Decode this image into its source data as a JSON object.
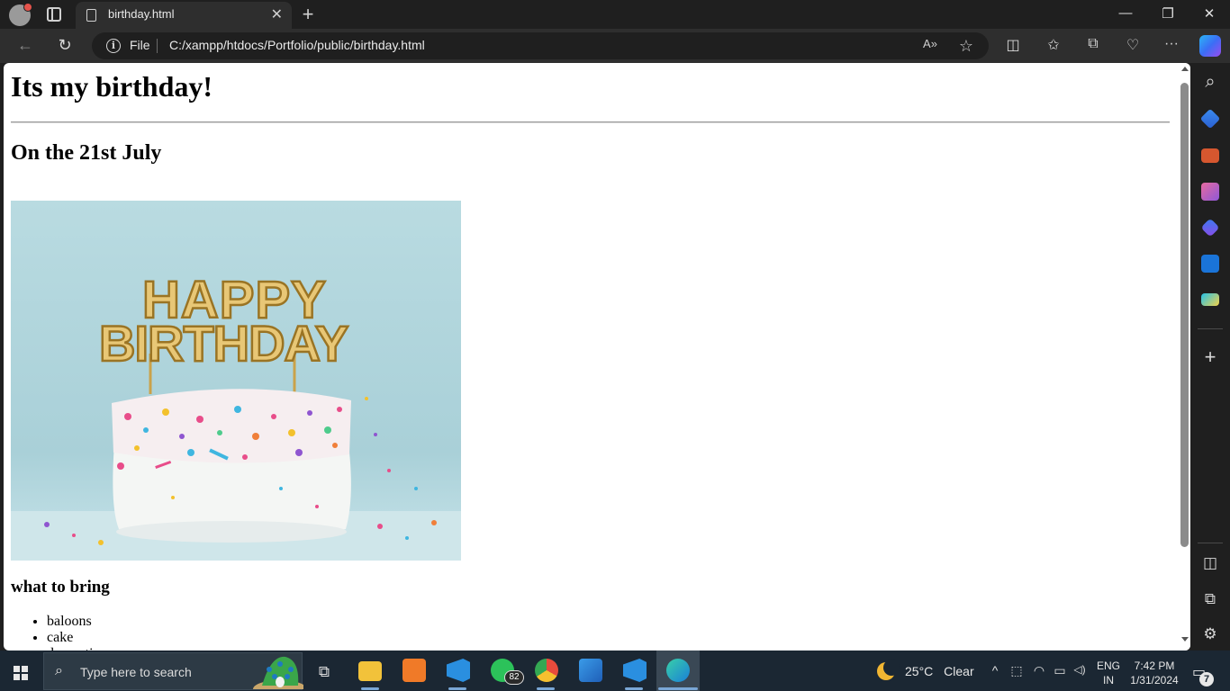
{
  "browser": {
    "tab_title": "birthday.html",
    "tab_close_glyph": "✕",
    "new_tab_glyph": "+",
    "window_controls": {
      "minimize": "—",
      "restore": "❐",
      "close": "✕"
    },
    "back_glyph": "←",
    "refresh_glyph": "↻",
    "info_glyph": "i",
    "file_label": "File",
    "url": "C:/xampp/htdocs/Portfolio/public/birthday.html",
    "read_aloud_glyph": "A»",
    "favorite_glyph": "☆",
    "split_glyph": "◫",
    "favorites_glyph": "✩",
    "collections_glyph": "⧉",
    "performance_glyph": "♡",
    "more_glyph": "···",
    "colors": {
      "chrome": "#1f1f1f",
      "toolbar": "#2e2e2e",
      "taskbar": "#1b2733"
    }
  },
  "page": {
    "heading": "Its my birthday!",
    "subheading": "On the 21st July",
    "image": {
      "icon": "birthday-cake-image",
      "topper_text": "HAPPY BIRTHDAY"
    },
    "list_heading": "what to bring",
    "list_items": [
      "baloons",
      "cake",
      "decorations"
    ]
  },
  "sidebar": {
    "icons": [
      "search-icon",
      "shopping-tag-icon",
      "tools-icon",
      "games-icon",
      "microsoft-365-icon",
      "outlook-icon",
      "drop-icon",
      "add-icon",
      "sidebar-toggle-icon",
      "external-link-icon",
      "settings-icon"
    ],
    "add_glyph": "+",
    "panel_glyph": "◫",
    "external_glyph": "⧉",
    "settings_glyph": "⚙",
    "search_glyph": "⌕"
  },
  "taskbar": {
    "search_placeholder": "Type here to search",
    "search_glyph": "⌕",
    "task_view_glyph": "⧉",
    "whatsapp_badge": "82",
    "weather_temp": "25°C",
    "weather_text": "Clear",
    "tray_up_glyph": "^",
    "tray_meet_glyph": "⬚",
    "tray_wifi_glyph": "◠",
    "tray_battery_glyph": "▭",
    "tray_volume_glyph": "◁)",
    "language": "ENG",
    "region": "IN",
    "time": "7:42 PM",
    "date": "1/31/2024",
    "notification_glyph": "▭",
    "notification_count": "7"
  }
}
